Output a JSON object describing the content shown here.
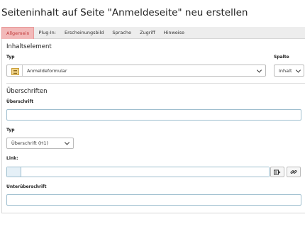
{
  "page": {
    "title": "Seiteninhalt auf Seite \"Anmeldeseite\" neu erstellen"
  },
  "tabs": [
    {
      "label": "Allgemein",
      "active": true
    },
    {
      "label": "Plug-In:",
      "active": false
    },
    {
      "label": "Erscheinungsbild",
      "active": false
    },
    {
      "label": "Sprache",
      "active": false
    },
    {
      "label": "Zugriff",
      "active": false
    },
    {
      "label": "Hinweise",
      "active": false
    }
  ],
  "content_element": {
    "heading": "Inhaltselement",
    "type_label": "Typ",
    "type_value": "Anmeldeformular",
    "type_icon": "form-icon",
    "column_label": "Spalte",
    "column_value": "Inhalt"
  },
  "headers": {
    "heading": "Überschriften",
    "header_label": "Überschrift",
    "header_value": "",
    "layout_label": "Typ",
    "layout_value": "Überschrift (H1)",
    "link_label": "Link:",
    "link_value": "",
    "subheader_label": "Unterüberschrift",
    "subheader_value": ""
  },
  "colors": {
    "active_tab_bg": "#f2b9b9",
    "active_tab_text": "#c23a3a",
    "input_border": "#9fbfcf",
    "link_addon_bg": "#e5f0f7"
  }
}
